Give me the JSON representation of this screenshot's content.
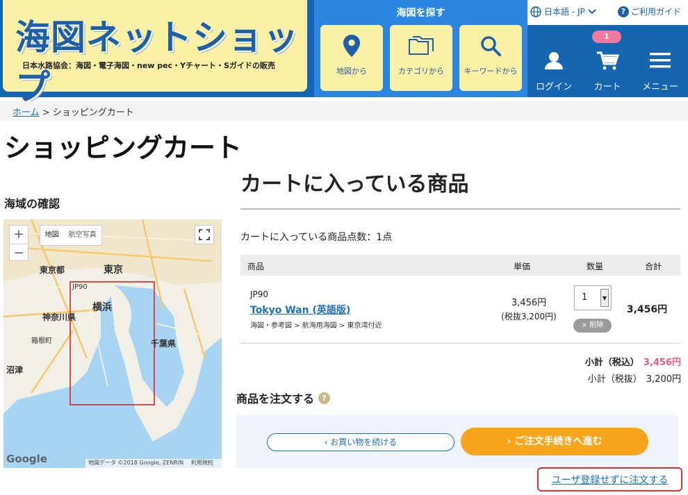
{
  "header": {
    "logo_title": "海図ネットショップ",
    "logo_subtitle": "日本水路協会：海図・電子海図・new pec・Yチャート・Sガイドの販売",
    "find": {
      "title": "海図を探す",
      "buttons": [
        {
          "label": "地図から",
          "icon": "map-pin-icon"
        },
        {
          "label": "カテゴリから",
          "icon": "folder-icon"
        },
        {
          "label": "キーワードから",
          "icon": "search-icon"
        }
      ]
    },
    "language": "日本語 - JP",
    "guide": "ご利用ガイド",
    "nav": {
      "login": "ログイン",
      "cart": "カート",
      "menu": "メニュー",
      "cart_count": "1"
    }
  },
  "breadcrumb": {
    "home": "ホーム",
    "separator": " > ",
    "current": "ショッピングカート"
  },
  "page_title": "ショッピングカート",
  "region": {
    "heading": "海域の確認",
    "map": {
      "type_buttons": [
        "地図",
        "航空写真"
      ],
      "labels": [
        "東京都",
        "東京",
        "JP90",
        "横浜",
        "神奈川県",
        "箱根町",
        "千葉県",
        "沼津"
      ],
      "attribution": "地図データ ©2018 Google, ZENRIN",
      "terms": "利用規約",
      "google": "Google"
    }
  },
  "cart": {
    "heading": "カートに入っている商品",
    "count_text": "カートに入っている商品点数：1点",
    "columns": [
      "商品",
      "単価",
      "数量",
      "合計"
    ],
    "item": {
      "code": "JP90",
      "name": "Tokyo Wan (英語版)",
      "category": "海図・参考図 > 航海用海図 > 東京湾付近",
      "price": "3,456円",
      "price_ex_tax": "(税抜3,200円)",
      "quantity": "1",
      "delete_label": "× 削除",
      "total": "3,456円"
    },
    "subtotal_incl_label": "小計（税込）",
    "subtotal_incl": "3,456円",
    "subtotal_excl_label": "小計（税抜）",
    "subtotal_excl": "3,200円"
  },
  "order": {
    "heading": "商品を注文する",
    "continue_label": "‹ お買い物を続ける",
    "checkout_label": "› ご注文手続きへ進む",
    "guest_label": "ユーザ登録せずに注文する"
  },
  "colors": {
    "header_blue": "#1565b0",
    "find_blue": "#2a86e0",
    "logo_yellow": "#fbf1a6",
    "accent_pink": "#e0607e",
    "checkout_orange": "#f7a51d",
    "link_blue": "#1d6fc1"
  }
}
